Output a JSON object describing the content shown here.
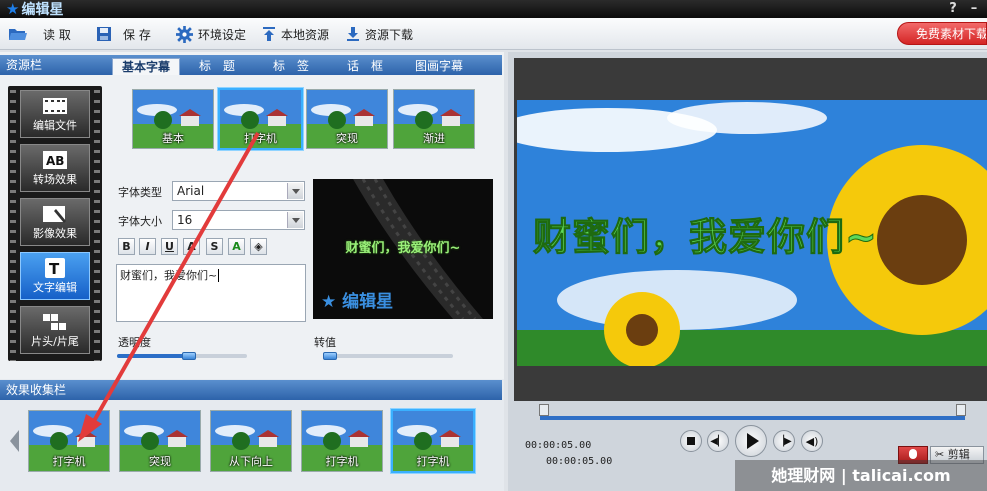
{
  "app": {
    "title": "编辑星",
    "help": "?",
    "minimize": "–"
  },
  "toolbar": {
    "read": "读 取",
    "save": "保 存",
    "settings": "环境设定",
    "local": "本地资源",
    "download": "资源下载",
    "promo": "免费素材下载"
  },
  "resource_panel": {
    "title": "资源栏",
    "tabs": [
      "基本字幕",
      "标　题",
      "标　签",
      "话　框",
      "图画字幕"
    ],
    "active_tab": "基本字幕",
    "categories": [
      "编辑文件",
      "转场效果",
      "影像效果",
      "文字编辑",
      "片头/片尾"
    ],
    "active_category": "文字编辑",
    "presets": [
      "基本",
      "打字机",
      "突现",
      "渐进"
    ],
    "selected_preset": "打字机"
  },
  "text_editor": {
    "font_type_label": "字体类型",
    "font_type_value": "Arial",
    "font_size_label": "字体大小",
    "font_size_value": "16",
    "format_buttons": [
      "B",
      "I",
      "U",
      "A",
      "S",
      "A",
      "◈"
    ],
    "text_value": "财蜜们，我爱你们~",
    "opacity_label": "透明度",
    "opacity_value": 0.55,
    "rotate_label": "转值",
    "rotate_value": 0.05
  },
  "small_preview": {
    "text": "财蜜们，我爱你们~",
    "watermark": "编辑星"
  },
  "collect_panel": {
    "title": "效果收集栏",
    "items": [
      "打字机",
      "突现",
      "从下向上",
      "打字机",
      "打字机"
    ],
    "selected_index": 4
  },
  "player": {
    "caption": "财蜜们，我爱你们~",
    "time_current": "00:00:05.00",
    "time_total": "00:00:05.00",
    "progress": 1.0,
    "clip_label": "剪辑"
  },
  "watermark": {
    "text": "她理财网 | talicai.com"
  }
}
